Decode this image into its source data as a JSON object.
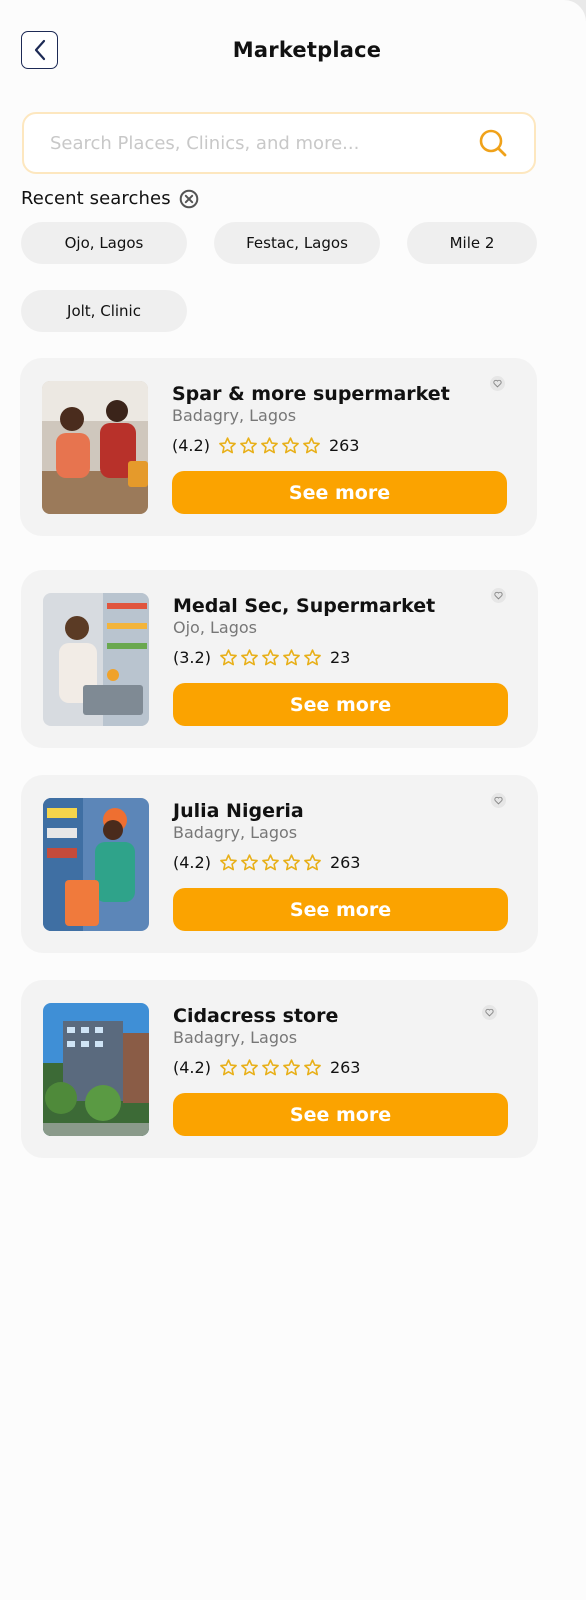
{
  "header": {
    "title": "Marketplace",
    "back_icon": "chevron-left-icon"
  },
  "search": {
    "placeholder": "Search Places, Clinics, and more...",
    "value": "",
    "icon": "search-icon"
  },
  "recent": {
    "title": "Recent searches",
    "chips": [
      "Ojo, Lagos",
      "Festac, Lagos",
      "Mile 2",
      "Jolt, Clinic"
    ]
  },
  "stores": [
    {
      "name": "Spar & more supermarket",
      "location": "Badagry, Lagos",
      "rating": "(4.2)",
      "stars": 5,
      "reviews": "263",
      "button": "See more"
    },
    {
      "name": "Medal Sec, Supermarket",
      "location": "Ojo, Lagos",
      "rating": "(3.2)",
      "stars": 5,
      "reviews": "23",
      "button": "See more"
    },
    {
      "name": "Julia Nigeria",
      "location": "Badagry, Lagos",
      "rating": "(4.2)",
      "stars": 5,
      "reviews": "263",
      "button": "See more"
    },
    {
      "name": "Cidacress store",
      "location": "Badagry, Lagos",
      "rating": "(4.2)",
      "stars": 5,
      "reviews": "263",
      "button": "See more"
    }
  ],
  "colors": {
    "accent": "#fba300",
    "star": "#e8b01a",
    "card_bg": "#f3f3f3",
    "chip_bg": "#efefef",
    "back_border": "#1d2a55"
  }
}
